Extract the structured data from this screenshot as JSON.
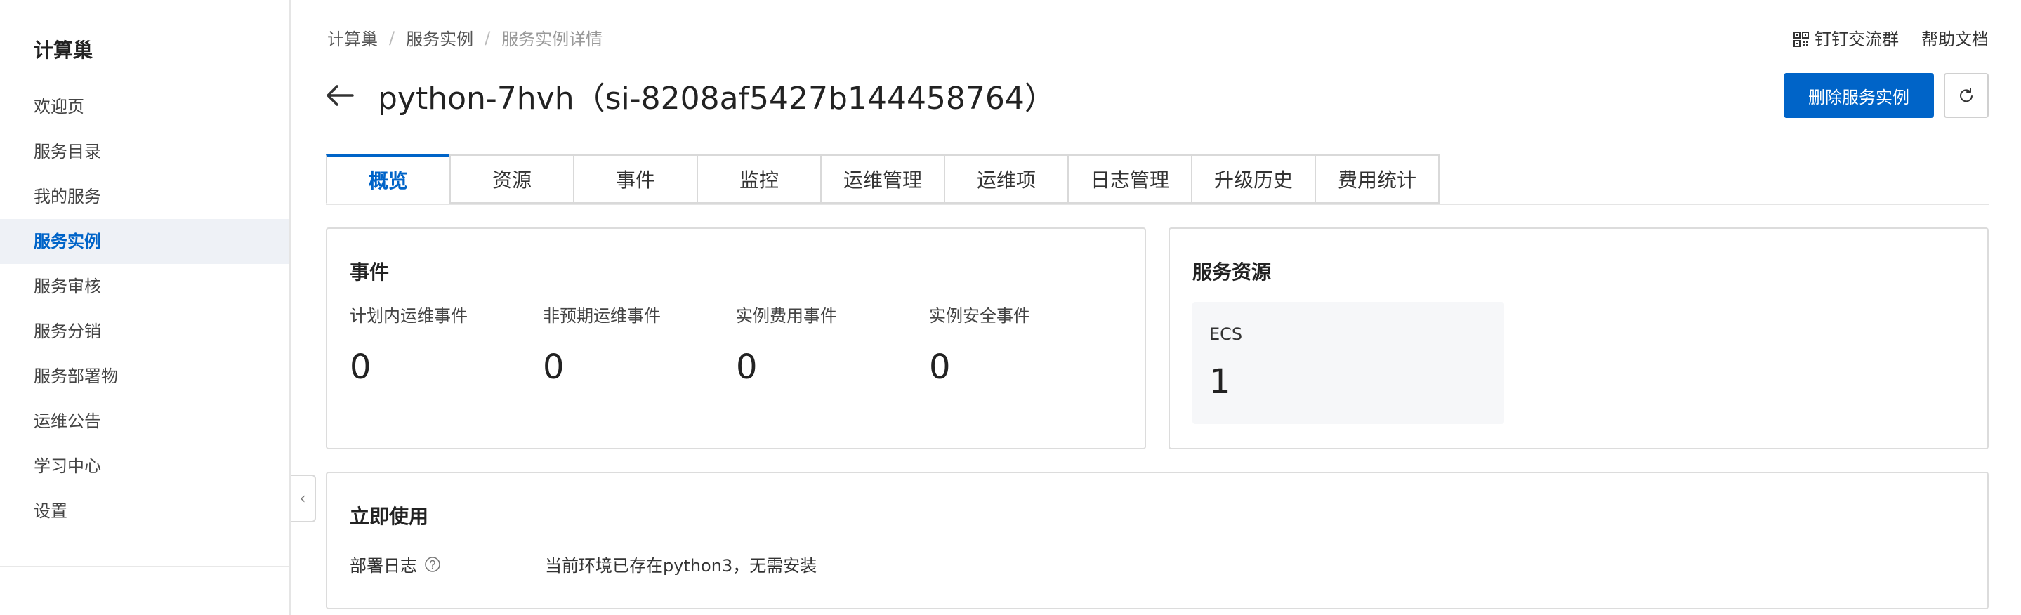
{
  "sidebar": {
    "title": "计算巢",
    "items": [
      {
        "label": "欢迎页"
      },
      {
        "label": "服务目录"
      },
      {
        "label": "我的服务"
      },
      {
        "label": "服务实例"
      },
      {
        "label": "服务审核"
      },
      {
        "label": "服务分销"
      },
      {
        "label": "服务部署物"
      },
      {
        "label": "运维公告"
      },
      {
        "label": "学习中心"
      },
      {
        "label": "设置"
      }
    ],
    "active_index": 3
  },
  "breadcrumb": {
    "items": [
      "计算巢",
      "服务实例",
      "服务实例详情"
    ],
    "separator": "/"
  },
  "top_links": {
    "dingtalk_label": "钉钉交流群",
    "help_label": "帮助文档"
  },
  "header": {
    "title": "python-7hvh（si-8208af5427b144458764）",
    "delete_label": "删除服务实例"
  },
  "tabs": [
    {
      "label": "概览"
    },
    {
      "label": "资源"
    },
    {
      "label": "事件"
    },
    {
      "label": "监控"
    },
    {
      "label": "运维管理"
    },
    {
      "label": "运维项"
    },
    {
      "label": "日志管理"
    },
    {
      "label": "升级历史"
    },
    {
      "label": "费用统计"
    }
  ],
  "active_tab": 0,
  "events_card": {
    "title": "事件",
    "items": [
      {
        "label": "计划内运维事件",
        "value": "0"
      },
      {
        "label": "非预期运维事件",
        "value": "0"
      },
      {
        "label": "实例费用事件",
        "value": "0"
      },
      {
        "label": "实例安全事件",
        "value": "0"
      }
    ]
  },
  "resources_card": {
    "title": "服务资源",
    "items": [
      {
        "label": "ECS",
        "value": "1"
      }
    ]
  },
  "use_card": {
    "title": "立即使用",
    "log_label": "部署日志",
    "log_text": "当前环境已存在python3，无需安装"
  },
  "colors": {
    "primary": "#0064c8",
    "active_bg": "#eef1f6"
  }
}
